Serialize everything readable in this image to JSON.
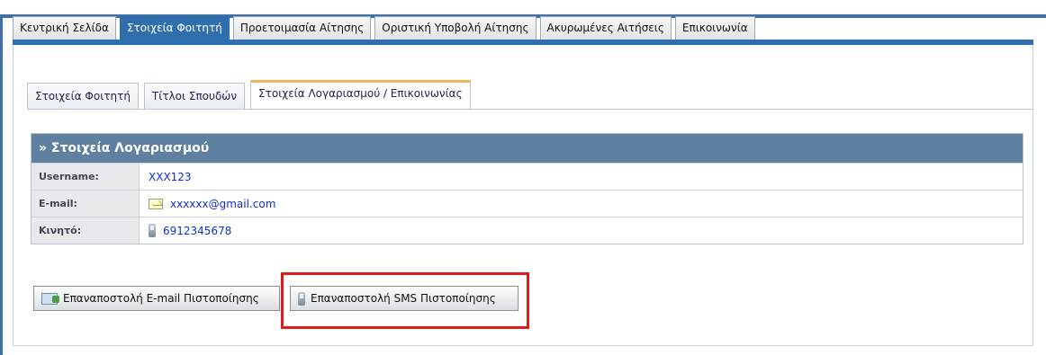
{
  "main_tabs": [
    {
      "label": "Κεντρική Σελίδα",
      "active": false
    },
    {
      "label": "Στοιχεία Φοιτητή",
      "active": true
    },
    {
      "label": "Προετοιμασία Αίτησης",
      "active": false
    },
    {
      "label": "Οριστική Υποβολή Αίτησης",
      "active": false
    },
    {
      "label": "Ακυρωμένες Αιτήσεις",
      "active": false
    },
    {
      "label": "Επικοινωνία",
      "active": false
    }
  ],
  "sub_tabs": [
    {
      "label": "Στοιχεία Φοιτητή",
      "active": false
    },
    {
      "label": "Τίτλοι Σπουδών",
      "active": false
    },
    {
      "label": "Στοιχεία Λογαριασμού / Επικοινωνίας",
      "active": true
    }
  ],
  "account": {
    "title": "» Στοιχεία Λογαριασμού",
    "rows": [
      {
        "label": "Username:",
        "value": "XXX123",
        "icon": ""
      },
      {
        "label": "E-mail:",
        "value": "xxxxxx@gmail.com",
        "icon": "mail-edit-icon"
      },
      {
        "label": "Κινητό:",
        "value": "6912345678",
        "icon": "mobile-phone-icon"
      }
    ]
  },
  "buttons": {
    "resend_email": "Επαναποστολή E-mail Πιστοποίησης",
    "resend_sms": "Επαναποστολή SMS Πιστοποίησης"
  },
  "colors": {
    "accent": "#2f6fae",
    "header": "#5f80a0",
    "highlight": "#e01a1a",
    "link": "#1330c8"
  }
}
